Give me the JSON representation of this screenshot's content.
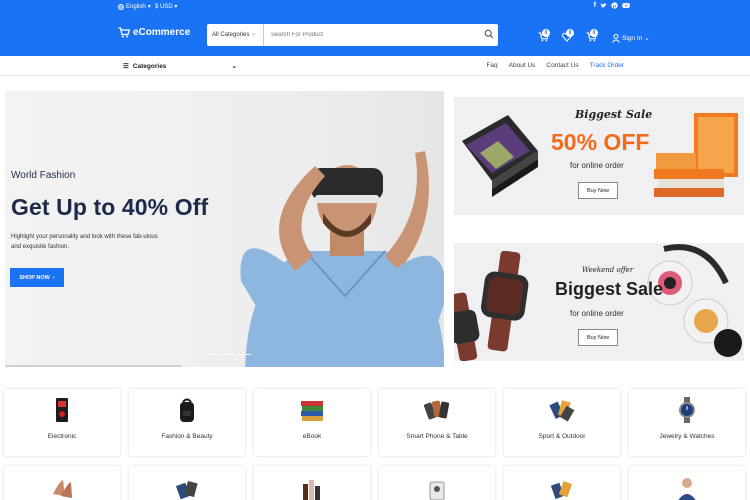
{
  "topbar": {
    "language": "English",
    "currency": "$ USD",
    "social_icons": [
      "facebook-icon",
      "twitter-icon",
      "pinterest-icon",
      "youtube-icon"
    ]
  },
  "header": {
    "logo_text": "eCommerce",
    "search_category": "All Categories",
    "search_placeholder": "Search For Product",
    "cart_count": "0",
    "wishlist_count": "0",
    "compare_count": "0",
    "signin_label": "Sign In"
  },
  "nav": {
    "categories_label": "Categories",
    "links": [
      "Faq",
      "About Us",
      "Contact Us",
      "Track Order"
    ],
    "active_link": "Track Order"
  },
  "hero": {
    "subtitle": "World Fashion",
    "title": "Get Up to 40% Off",
    "description": "Highlight your personality and look with these fab-ulous and exquisite fashion.",
    "cta": "SHOP NOW"
  },
  "banners": [
    {
      "script": "Biggest Sale",
      "headline": "50% OFF",
      "subtext": "for online order",
      "button": "Buy Now"
    },
    {
      "script": "Weekend offer",
      "headline": "Biggest Sale",
      "subtext": "for online order",
      "button": "Buy Now"
    }
  ],
  "categories": [
    {
      "label": "Electronic",
      "icon": "pc-case-icon"
    },
    {
      "label": "Fashion & Beauty",
      "icon": "backpack-icon"
    },
    {
      "label": "eBook",
      "icon": "books-icon"
    },
    {
      "label": "Smart Phone & Table",
      "icon": "phones-icon"
    },
    {
      "label": "Sport & Outdoor",
      "icon": "sport-icon"
    },
    {
      "label": "Jewelry & Watches",
      "icon": "watch-icon"
    }
  ],
  "colors": {
    "brand": "#1a73f5",
    "heading": "#1e2a4a",
    "accent_orange": "#f26b1d"
  }
}
